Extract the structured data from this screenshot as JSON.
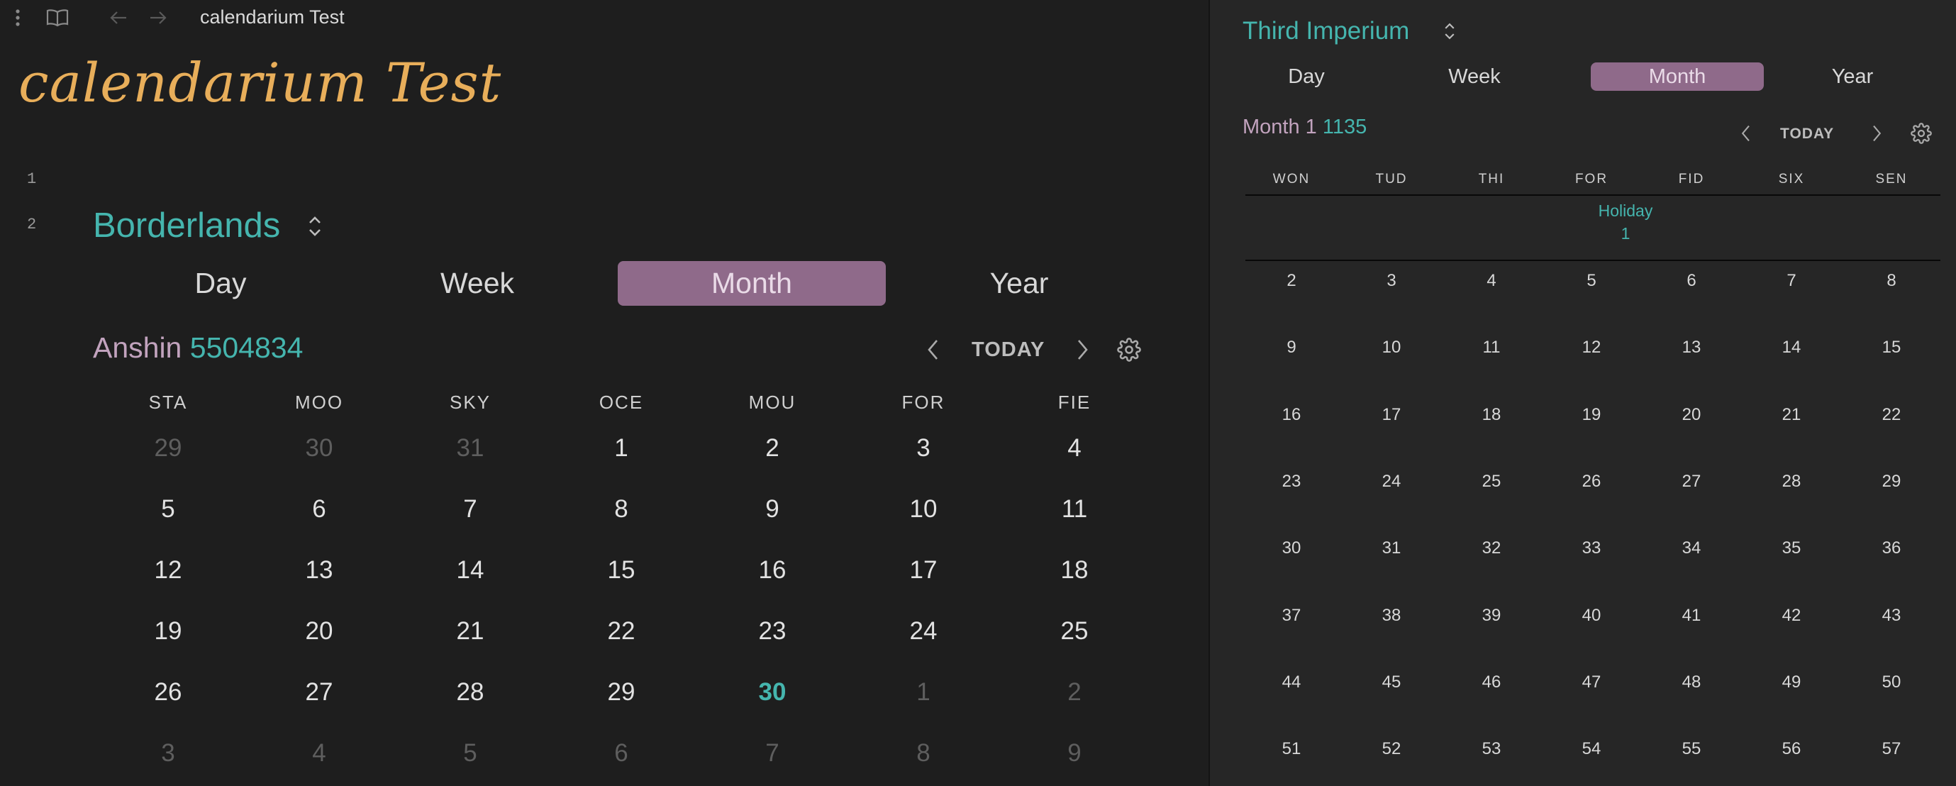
{
  "topbar": {
    "tab_title": "calendarium Test",
    "icons": [
      "more-vertical-icon",
      "book-icon",
      "arrow-left-icon",
      "arrow-right-icon"
    ]
  },
  "note": {
    "title": "calendarium Test",
    "line_numbers": [
      "1",
      "2"
    ]
  },
  "left_calendar": {
    "name": "Borderlands",
    "views": [
      "Day",
      "Week",
      "Month",
      "Year"
    ],
    "active_view": "Month",
    "month_name": "Anshin",
    "year": "5504834",
    "today_label": "TODAY",
    "weekdays": [
      "STA",
      "MOO",
      "SKY",
      "OCE",
      "MOU",
      "FOR",
      "FIE"
    ],
    "weeks": [
      [
        {
          "d": "29",
          "t": "other"
        },
        {
          "d": "30",
          "t": "other"
        },
        {
          "d": "31",
          "t": "other"
        },
        {
          "d": "1",
          "t": "cur"
        },
        {
          "d": "2",
          "t": "cur"
        },
        {
          "d": "3",
          "t": "cur"
        },
        {
          "d": "4",
          "t": "cur"
        }
      ],
      [
        {
          "d": "5",
          "t": "cur"
        },
        {
          "d": "6",
          "t": "cur"
        },
        {
          "d": "7",
          "t": "cur"
        },
        {
          "d": "8",
          "t": "cur"
        },
        {
          "d": "9",
          "t": "cur"
        },
        {
          "d": "10",
          "t": "cur"
        },
        {
          "d": "11",
          "t": "cur"
        }
      ],
      [
        {
          "d": "12",
          "t": "cur"
        },
        {
          "d": "13",
          "t": "cur"
        },
        {
          "d": "14",
          "t": "cur"
        },
        {
          "d": "15",
          "t": "cur"
        },
        {
          "d": "16",
          "t": "cur"
        },
        {
          "d": "17",
          "t": "cur"
        },
        {
          "d": "18",
          "t": "cur"
        }
      ],
      [
        {
          "d": "19",
          "t": "cur"
        },
        {
          "d": "20",
          "t": "cur"
        },
        {
          "d": "21",
          "t": "cur"
        },
        {
          "d": "22",
          "t": "cur"
        },
        {
          "d": "23",
          "t": "cur"
        },
        {
          "d": "24",
          "t": "cur"
        },
        {
          "d": "25",
          "t": "cur"
        }
      ],
      [
        {
          "d": "26",
          "t": "cur"
        },
        {
          "d": "27",
          "t": "cur"
        },
        {
          "d": "28",
          "t": "cur"
        },
        {
          "d": "29",
          "t": "cur"
        },
        {
          "d": "30",
          "t": "today"
        },
        {
          "d": "1",
          "t": "other"
        },
        {
          "d": "2",
          "t": "other"
        }
      ],
      [
        {
          "d": "3",
          "t": "other"
        },
        {
          "d": "4",
          "t": "other"
        },
        {
          "d": "5",
          "t": "other"
        },
        {
          "d": "6",
          "t": "other"
        },
        {
          "d": "7",
          "t": "other"
        },
        {
          "d": "8",
          "t": "other"
        },
        {
          "d": "9",
          "t": "other"
        }
      ]
    ]
  },
  "right_calendar": {
    "name": "Third Imperium",
    "views": [
      "Day",
      "Week",
      "Month",
      "Year"
    ],
    "active_view": "Month",
    "month_name": "Month 1",
    "year": "1135",
    "today_label": "TODAY",
    "weekdays": [
      "WON",
      "TUD",
      "THI",
      "FOR",
      "FID",
      "SIX",
      "SEN"
    ],
    "holiday": {
      "label": "Holiday",
      "day": "1"
    },
    "weeks": [
      [
        "2",
        "3",
        "4",
        "5",
        "6",
        "7",
        "8"
      ],
      [
        "9",
        "10",
        "11",
        "12",
        "13",
        "14",
        "15"
      ],
      [
        "16",
        "17",
        "18",
        "19",
        "20",
        "21",
        "22"
      ],
      [
        "23",
        "24",
        "25",
        "26",
        "27",
        "28",
        "29"
      ],
      [
        "30",
        "31",
        "32",
        "33",
        "34",
        "35",
        "36"
      ],
      [
        "37",
        "38",
        "39",
        "40",
        "41",
        "42",
        "43"
      ],
      [
        "44",
        "45",
        "46",
        "47",
        "48",
        "49",
        "50"
      ],
      [
        "51",
        "52",
        "53",
        "54",
        "55",
        "56",
        "57"
      ]
    ]
  },
  "colors": {
    "accent_teal": "#45b5ae",
    "title_orange": "#e8ae5a",
    "active_view_bg": "#8f6a8a",
    "month_name": "#c2a3be"
  }
}
